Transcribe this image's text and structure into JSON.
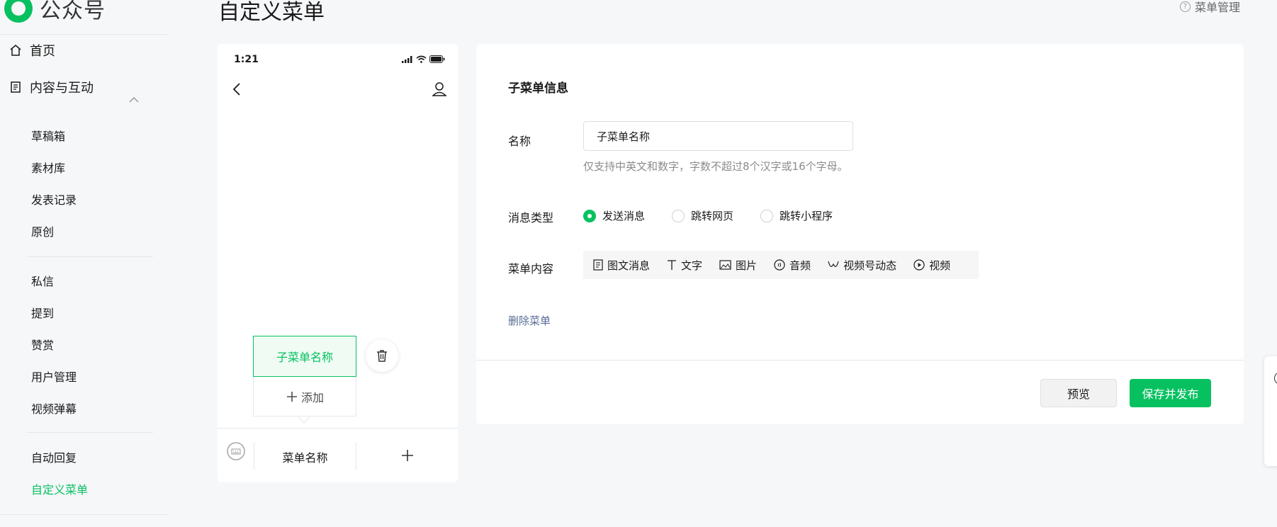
{
  "brand": {
    "name": "公众号",
    "color": "#07c160"
  },
  "sidebar": {
    "home": "首页",
    "content_group": "内容与互动",
    "items": [
      "草稿箱",
      "素材库",
      "发表记录",
      "原创",
      "私信",
      "提到",
      "赞赏",
      "用户管理",
      "视频弹幕",
      "自动回复",
      "自定义菜单"
    ],
    "active_item": "自定义菜单"
  },
  "header": {
    "title": "自定义菜单",
    "help_link": "菜单管理",
    "help_icon": "?"
  },
  "phone": {
    "time": "1:21",
    "submenu_label": "子菜单名称",
    "add_submenu_label": "添加",
    "main_menu_label": "菜单名称"
  },
  "form": {
    "title": "子菜单信息",
    "name_label": "名称",
    "name_value": "子菜单名称",
    "name_hint": "仅支持中英文和数字，字数不超过8个汉字或16个字母。",
    "msg_type_label": "消息类型",
    "msg_types": [
      "发送消息",
      "跳转网页",
      "跳转小程序"
    ],
    "selected_msg_type": "发送消息",
    "content_label": "菜单内容",
    "content_types": [
      "图文消息",
      "文字",
      "图片",
      "音频",
      "视频号动态",
      "视频"
    ],
    "delete_label": "删除菜单",
    "preview_label": "预览",
    "publish_label": "保存并发布"
  }
}
